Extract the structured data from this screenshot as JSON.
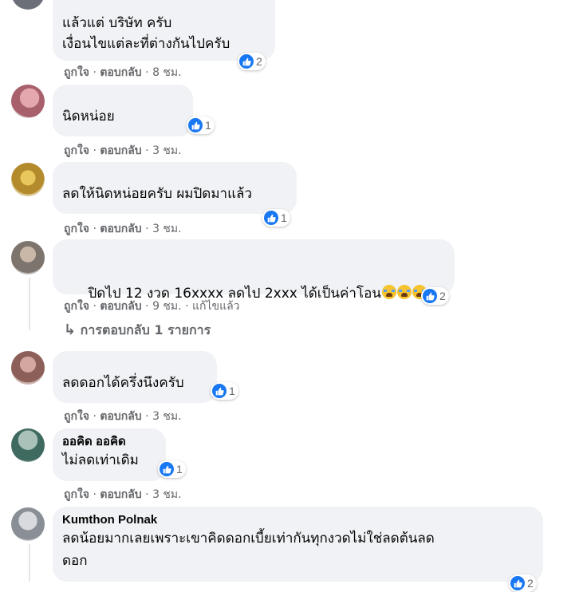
{
  "comments": [
    {
      "author": "",
      "lines": [
        "แล้วแต่ บริษัท ครับ",
        "เงื่อนไขแต่ละที่ต่างกันไปครับ"
      ],
      "reaction_count": "2",
      "like": "ถูกใจ",
      "reply": "ตอบกลับ",
      "time": "8 ชม.",
      "avatar_color": "#6a6f78"
    },
    {
      "author": "",
      "lines": [
        "นิดหน่อย"
      ],
      "reaction_count": "1",
      "like": "ถูกใจ",
      "reply": "ตอบกลับ",
      "time": "3 ชม.",
      "avatar_color": "#c98b92"
    },
    {
      "author": "",
      "lines": [
        "ลดให้นิดหน่อยครับ ผมปิดมาแล้ว"
      ],
      "reaction_count": "1",
      "like": "ถูกใจ",
      "reply": "ตอบกลับ",
      "time": "3 ชม.",
      "avatar_color": "#c7a24a"
    },
    {
      "author": "",
      "lines": [
        "ปิดไป 12 งวด 16xxxx ลดไป 2xxx ได้เป็นค่าโอน"
      ],
      "reaction_count": "2",
      "like": "ถูกใจ",
      "reply": "ตอบกลับ",
      "time": "9 ชม.",
      "edited": "แก้ไขแล้ว",
      "avatar_color": "#8a8f96"
    },
    {
      "author": "",
      "lines": [
        "ลดดอกได้ครึ่งนึงครับ"
      ],
      "reaction_count": "1",
      "like": "ถูกใจ",
      "reply": "ตอบกลับ",
      "time": "3 ชม.",
      "avatar_color": "#9a6f6a"
    },
    {
      "author": "ออคิด ออคิด",
      "lines": [
        "ไม่ลดเท่าเดิม"
      ],
      "reaction_count": "1",
      "like": "ถูกใจ",
      "reply": "ตอบกลับ",
      "time": "3 ชม.",
      "avatar_color": "#5c7a74"
    },
    {
      "author": "Kumthon Polnak",
      "lines": [
        "ลดน้อยมากเลยเพราะเขาคิดดอกเบี้ยเท่ากันทุกงวดไม่ใช่ลดต้นลด",
        "ดอก"
      ],
      "reaction_count": "2",
      "avatar_color": "#9aa0a6"
    }
  ],
  "reply_link": "การตอบกลับ 1 รายการ",
  "separator": "·",
  "colors": {
    "bubble": "#f0f2f5",
    "meta": "#65676b",
    "like_blue": "#1877f2"
  }
}
